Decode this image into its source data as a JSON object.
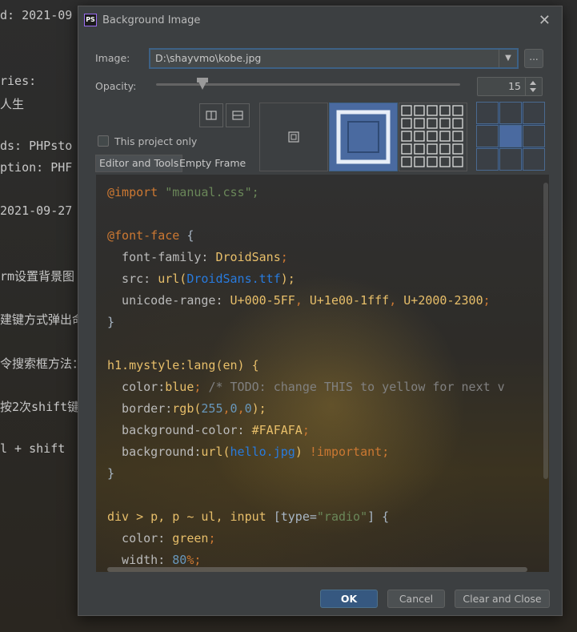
{
  "background_editor": {
    "lines": [
      "d: 2021-09",
      "ries:",
      "人生",
      "ds: PHPsto",
      "ption: PHF",
      "2021-09-27",
      "rm设置背景图",
      "建键方式弹出命",
      "令搜索框方法：",
      "按2次shift键",
      "l + shift"
    ]
  },
  "dialog": {
    "title": "Background Image",
    "app_icon_text": "PS",
    "close_glyph": "✕",
    "image_label": "Image:",
    "image_path": "D:\\shayvmo\\kobe.jpg",
    "browse_label": "...",
    "opacity_label": "Opacity:",
    "opacity_value": "15",
    "opacity_fraction": 0.15,
    "this_project_only": "This project only",
    "tabs": [
      "Editor and Tools",
      "Empty Frame"
    ],
    "buttons": {
      "ok": "OK",
      "cancel": "Cancel",
      "clear": "Clear and Close"
    }
  },
  "editor_code": {
    "l1": [
      "@import",
      " \"manual.css\";"
    ],
    "l2": [
      "@font-face",
      " {"
    ],
    "l3": [
      "  font-family: ",
      "DroidSans",
      ";"
    ],
    "l4": [
      "  src: ",
      "url(",
      "DroidSans.ttf",
      ");"
    ],
    "l5": [
      "  unicode-range: ",
      "U+000-5FF",
      ", ",
      "U+1e00-1fff",
      ", ",
      "U+2000-2300",
      ";"
    ],
    "l6": [
      "}"
    ],
    "l7": [
      "h1.mystyle:lang(en) {"
    ],
    "l8": [
      "  color:",
      "blue",
      "; ",
      "/* TODO: change THIS to yellow for next v"
    ],
    "l9": [
      "  border:",
      "rgb(",
      "255",
      ",",
      "0",
      ",",
      "0",
      ");"
    ],
    "l10": [
      "  background-color: ",
      "#FAFAFA",
      ";"
    ],
    "l11": [
      "  background:",
      "url(",
      "hello.jpg",
      ") ",
      "!important",
      ";"
    ],
    "l12": [
      "}"
    ],
    "l13": [
      "div > p, p ~ ul, input ",
      "[type=",
      "\"radio\"",
      "] {"
    ],
    "l14": [
      "  color: ",
      "green",
      ";"
    ],
    "l15": [
      "  width: ",
      "80",
      "%;"
    ]
  },
  "colors": {
    "accent": "#365880",
    "focus_border": "#3d6185"
  }
}
